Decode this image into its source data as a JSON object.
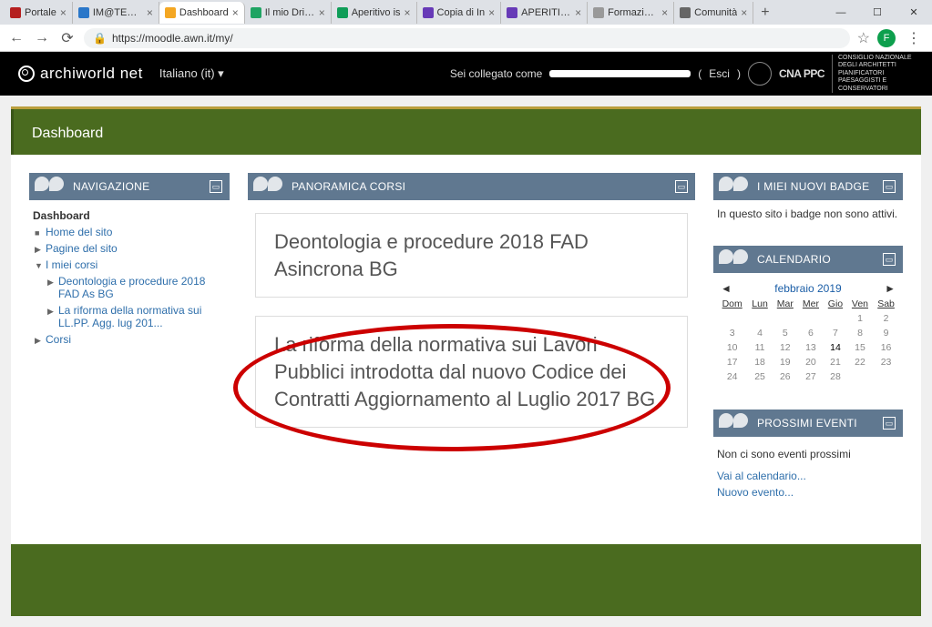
{
  "browser": {
    "tabs": [
      {
        "title": "Portale",
        "icon_color": "#b51f1f"
      },
      {
        "title": "IM@TERIA",
        "icon_color": "#2a77c9"
      },
      {
        "title": "Dashboard",
        "icon_color": "#f4a723",
        "active": true
      },
      {
        "title": "Il mio Drive",
        "icon_color": "#1fa463"
      },
      {
        "title": "Aperitivo is",
        "icon_color": "#0f9d58"
      },
      {
        "title": "Copia di In",
        "icon_color": "#673ab7"
      },
      {
        "title": "APERITIVO",
        "icon_color": "#673ab7"
      },
      {
        "title": "Formazione",
        "icon_color": "#999"
      },
      {
        "title": "Comunità",
        "icon_color": "#666"
      }
    ],
    "url": "https://moodle.awn.it/my/",
    "avatar_initial": "F"
  },
  "header": {
    "brand": "archiworld net",
    "lang": "Italiano (it)",
    "login_prefix": "Sei collegato come ",
    "logout": "Esci",
    "org_text": "CNA PPC",
    "org_desc": "CONSIGLIO NAZIONALE DEGLI ARCHITETTI PIANIFICATORI PAESAGGISTI E CONSERVATORI"
  },
  "page": {
    "title": "Dashboard",
    "blocks": {
      "navigation": {
        "title": "NAVIGAZIONE",
        "items": {
          "dashboard": "Dashboard",
          "home": "Home del sito",
          "site_pages": "Pagine del sito",
          "my_courses": "I miei corsi",
          "course1": "Deontologia e procedure 2018 FAD As BG",
          "course2": "La riforma della normativa sui LL.PP. Agg. lug 201...",
          "courses": "Corsi"
        }
      },
      "course_overview": {
        "title": "PANORAMICA CORSI",
        "cards": [
          "Deontologia e procedure 2018 FAD Asincrona BG",
          "La riforma della normativa sui Lavori Pubblici introdotta dal nuovo Codice dei Contratti Aggiornamento al Luglio 2017 BG"
        ]
      },
      "badges": {
        "title": "I MIEI NUOVI BADGE",
        "text": "In questo sito i badge non sono attivi."
      },
      "calendar": {
        "title": "CALENDARIO",
        "month": "febbraio 2019",
        "weekdays": [
          "Dom",
          "Lun",
          "Mar",
          "Mer",
          "Gio",
          "Ven",
          "Sab"
        ],
        "weeks": [
          [
            "",
            "",
            "",
            "",
            "",
            "1",
            "2"
          ],
          [
            "3",
            "4",
            "5",
            "6",
            "7",
            "8",
            "9"
          ],
          [
            "10",
            "11",
            "12",
            "13",
            "14",
            "15",
            "16"
          ],
          [
            "17",
            "18",
            "19",
            "20",
            "21",
            "22",
            "23"
          ],
          [
            "24",
            "25",
            "26",
            "27",
            "28",
            "",
            ""
          ]
        ],
        "today": "14"
      },
      "events": {
        "title": "PROSSIMI EVENTI",
        "text": "Non ci sono eventi prossimi",
        "link1": "Vai al calendario...",
        "link2": "Nuovo evento..."
      }
    }
  }
}
